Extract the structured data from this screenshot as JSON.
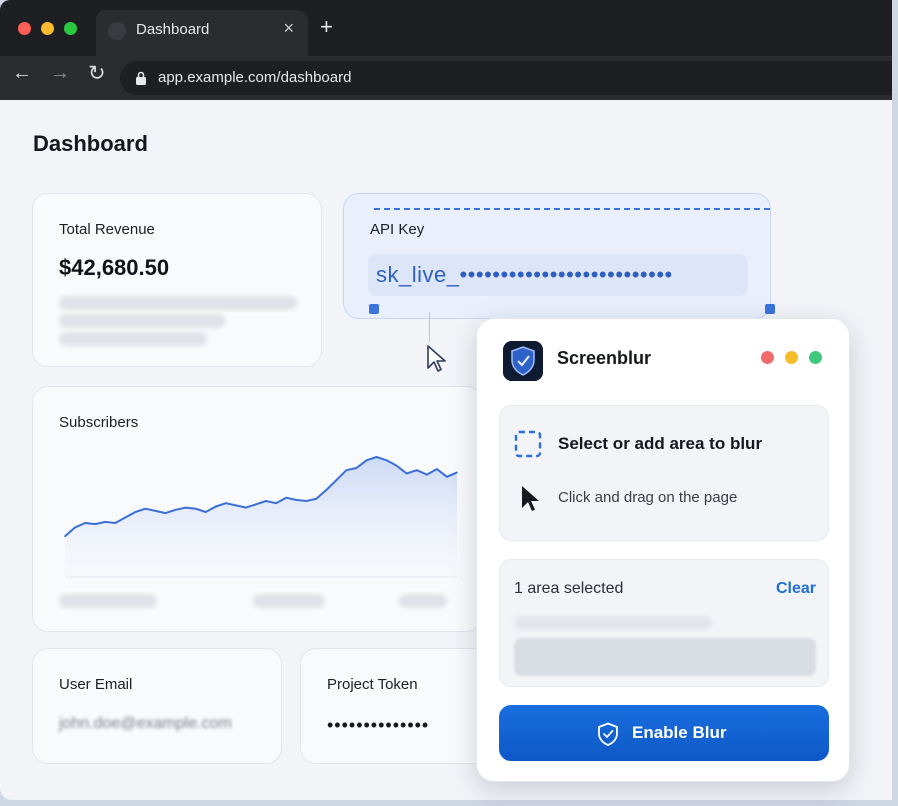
{
  "browser": {
    "tab_title": "Dashboard",
    "tab_close": "×",
    "new_tab": "+",
    "url": "app.example.com/dashboard",
    "back": "←",
    "forward": "→",
    "reload": "↻"
  },
  "dashboard": {
    "title": "Dashboard",
    "revenue": {
      "label": "Total Revenue",
      "value": "$42,680.50"
    },
    "api_key": {
      "label": "API Key",
      "value": "sk_live_••••••••••••••••••••••••••"
    },
    "subscribers": {
      "label": "Subscribers",
      "chart_data": {
        "type": "area",
        "title": "Subscribers",
        "xlabel": "",
        "ylabel": "",
        "values": [
          28,
          36,
          40,
          39,
          41,
          40,
          45,
          50,
          53,
          51,
          49,
          52,
          54,
          53,
          50,
          55,
          58,
          56,
          54,
          57,
          60,
          58,
          63,
          61,
          60,
          62,
          70,
          79,
          88,
          90,
          97,
          100,
          97,
          92,
          85,
          88,
          84,
          89,
          82,
          86
        ],
        "grid": false
      }
    },
    "user_email": {
      "label": "User Email",
      "value": "john.doe@example.com"
    },
    "project_token": {
      "label": "Project Token",
      "value": "••••••••••••••"
    }
  },
  "popup": {
    "app_name": "Screenblur",
    "select_title": "Select or add area to blur",
    "select_hint": "Click and drag on the page",
    "area_count": "1 area selected",
    "clear": "Clear",
    "enable_button": "Enable Blur"
  },
  "colors": {
    "accent": "#1a6ee0",
    "selection": "#3a74d9",
    "traffic_red": "#fe5f57",
    "traffic_yellow": "#febc2e",
    "traffic_green": "#28c840"
  }
}
